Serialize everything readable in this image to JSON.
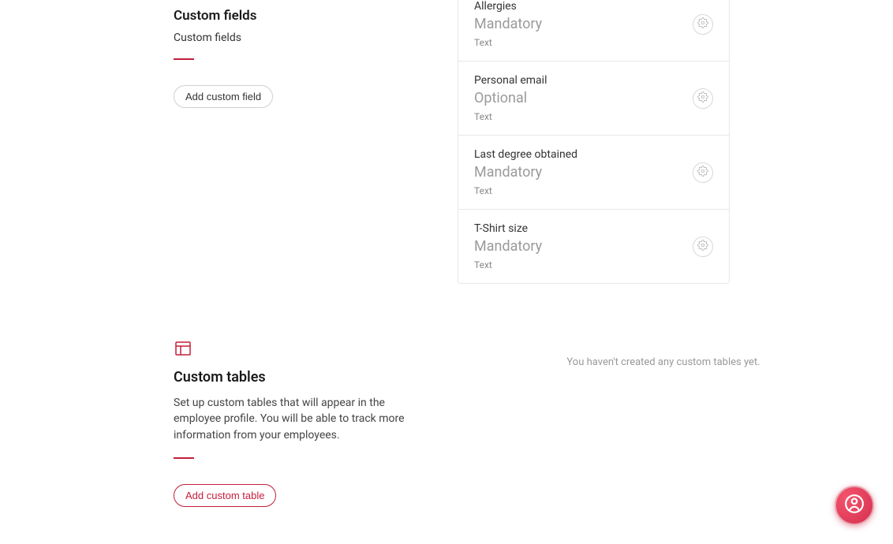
{
  "customFields": {
    "title": "Custom fields",
    "subtitle": "Custom fields",
    "addButton": "Add custom field"
  },
  "fields": [
    {
      "name": "Allergies",
      "requirement": "Mandatory",
      "type": "Text"
    },
    {
      "name": "Personal email",
      "requirement": "Optional",
      "type": "Text"
    },
    {
      "name": "Last degree obtained",
      "requirement": "Mandatory",
      "type": "Text"
    },
    {
      "name": "T-Shirt size",
      "requirement": "Mandatory",
      "type": "Text"
    }
  ],
  "customTables": {
    "title": "Custom tables",
    "description": "Set up custom tables that will appear in the employee profile. You will be able to track more information from your employees.",
    "addButton": "Add custom table",
    "emptyMessage": "You haven't created any custom tables yet."
  }
}
